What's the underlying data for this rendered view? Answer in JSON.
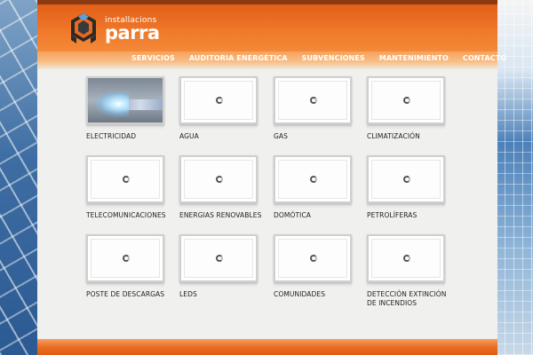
{
  "brand": {
    "small_text": "installacions",
    "big_text": "parra"
  },
  "nav": {
    "items": [
      {
        "label": "Servicios"
      },
      {
        "label": "Auditoria Energética"
      },
      {
        "label": "Subvenciones"
      },
      {
        "label": "Mantenimiento"
      },
      {
        "label": "Contacto"
      }
    ]
  },
  "services": [
    {
      "label": "ELECTRICIDAD",
      "state": "image"
    },
    {
      "label": "AGUA",
      "state": "loading"
    },
    {
      "label": "GAS",
      "state": "loading"
    },
    {
      "label": "CLIMATIZACIÓN",
      "state": "loading"
    },
    {
      "label": "TELECOMUNICACIONES",
      "state": "loading"
    },
    {
      "label": "ENERGIAS RENOVABLES",
      "state": "loading"
    },
    {
      "label": "DOMÓTICA",
      "state": "loading"
    },
    {
      "label": "PETROLÍFERAS",
      "state": "loading"
    },
    {
      "label": "POSTE DE DESCARGAS",
      "state": "loading"
    },
    {
      "label": "LEDS",
      "state": "loading"
    },
    {
      "label": "COMUNIDADES",
      "state": "loading"
    },
    {
      "label": "DETECCIÓN EXTINCIÓN DE INCENDIOS",
      "state": "loading"
    }
  ],
  "colors": {
    "header_orange": "#f07a2a",
    "top_dark": "#8a3a10",
    "page_bg": "#f0f0ef"
  }
}
